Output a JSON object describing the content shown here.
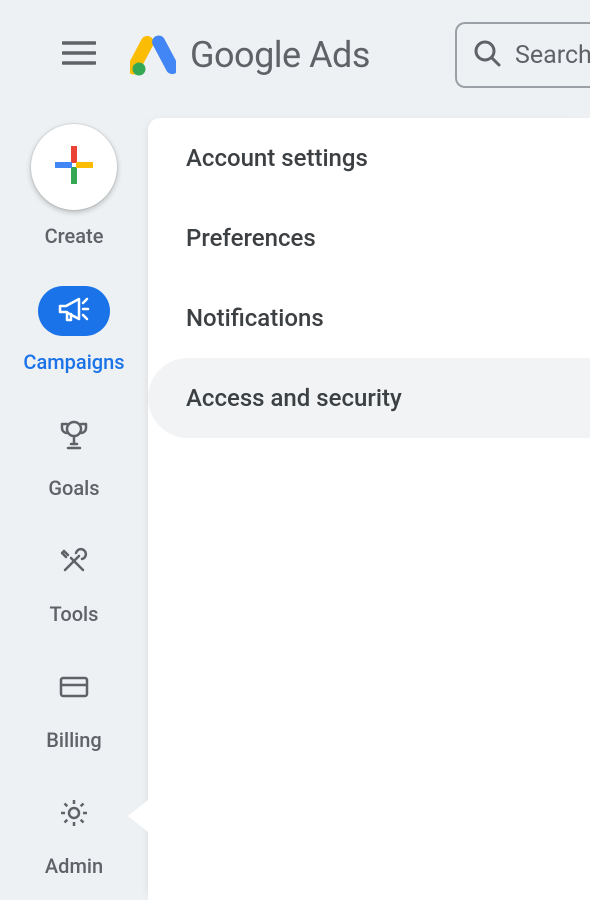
{
  "header": {
    "product_name": "Google Ads",
    "search_placeholder": "Search"
  },
  "rail": {
    "create_label": "Create",
    "items": [
      {
        "id": "campaigns",
        "label": "Campaigns",
        "active": true
      },
      {
        "id": "goals",
        "label": "Goals"
      },
      {
        "id": "tools",
        "label": "Tools"
      },
      {
        "id": "billing",
        "label": "Billing"
      },
      {
        "id": "admin",
        "label": "Admin"
      }
    ]
  },
  "submenu": {
    "items": [
      {
        "label": "Account settings"
      },
      {
        "label": "Preferences"
      },
      {
        "label": "Notifications"
      },
      {
        "label": "Access and security",
        "hover": true
      }
    ]
  }
}
